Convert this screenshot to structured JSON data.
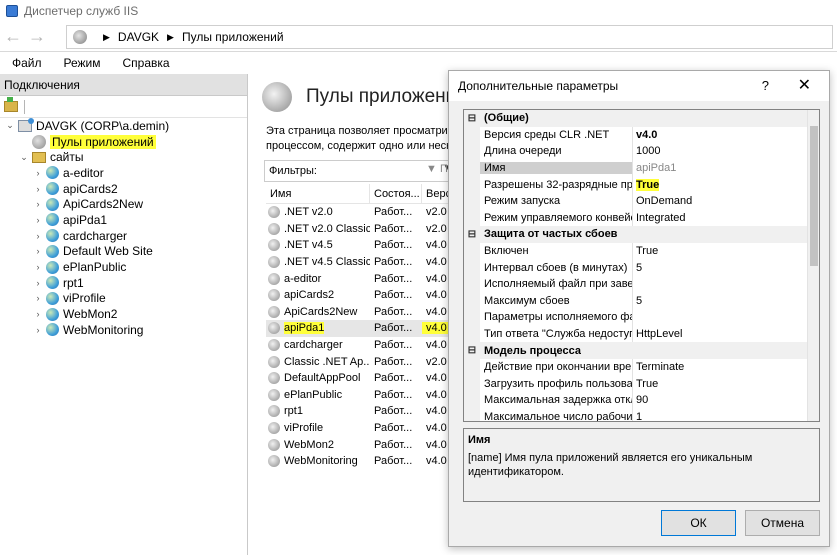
{
  "window": {
    "title": "Диспетчер служб IIS"
  },
  "address": {
    "crumbs": [
      "DAVGK",
      "Пулы приложений"
    ]
  },
  "menu": [
    "Файл",
    "Режим",
    "Справка"
  ],
  "connections": {
    "header": "Подключения",
    "tree": [
      {
        "label": "DAVGK (CORP\\a.demin)",
        "level": 0,
        "exp": "⌄",
        "icon": "server-icon"
      },
      {
        "label": "Пулы приложений",
        "level": 1,
        "exp": "",
        "icon": "app-pools-icon",
        "highlight": true
      },
      {
        "label": "сайты",
        "level": 1,
        "exp": "⌄",
        "icon": "sites-folder-icon"
      },
      {
        "label": "a-editor",
        "level": 2,
        "exp": "›",
        "icon": "site-icon"
      },
      {
        "label": "apiCards2",
        "level": 2,
        "exp": "›",
        "icon": "site-icon"
      },
      {
        "label": "ApiCards2New",
        "level": 2,
        "exp": "›",
        "icon": "site-icon"
      },
      {
        "label": "apiPda1",
        "level": 2,
        "exp": "›",
        "icon": "site-icon"
      },
      {
        "label": "cardcharger",
        "level": 2,
        "exp": "›",
        "icon": "site-icon"
      },
      {
        "label": "Default Web Site",
        "level": 2,
        "exp": "›",
        "icon": "site-icon"
      },
      {
        "label": "ePlanPublic",
        "level": 2,
        "exp": "›",
        "icon": "site-icon"
      },
      {
        "label": "rpt1",
        "level": 2,
        "exp": "›",
        "icon": "site-icon"
      },
      {
        "label": "viProfile",
        "level": 2,
        "exp": "›",
        "icon": "site-icon"
      },
      {
        "label": "WebMon2",
        "level": 2,
        "exp": "›",
        "icon": "site-icon"
      },
      {
        "label": "WebMonitoring",
        "level": 2,
        "exp": "›",
        "icon": "site-icon"
      }
    ]
  },
  "pools": {
    "title": "Пулы приложений",
    "description": [
      "Эта страница позволяет просматривать",
      "процессом, содержит одно или неско"
    ],
    "filter_label": "Фильтры:",
    "go_label": "▼ П",
    "columns": [
      "Имя",
      "Состоя...",
      "Верс"
    ],
    "rows": [
      {
        "name": ".NET v2.0",
        "state": "Работ...",
        "ver": "v2.0"
      },
      {
        "name": ".NET v2.0 Classic",
        "state": "Работ...",
        "ver": "v2.0"
      },
      {
        "name": ".NET v4.5",
        "state": "Работ...",
        "ver": "v4.0"
      },
      {
        "name": ".NET v4.5 Classic",
        "state": "Работ...",
        "ver": "v4.0"
      },
      {
        "name": "a-editor",
        "state": "Работ...",
        "ver": "v4.0"
      },
      {
        "name": "apiCards2",
        "state": "Работ...",
        "ver": "v4.0"
      },
      {
        "name": "ApiCards2New",
        "state": "Работ...",
        "ver": "v4.0"
      },
      {
        "name": "apiPda1",
        "state": "Работ...",
        "ver": "v4.0",
        "selected": true
      },
      {
        "name": "cardcharger",
        "state": "Работ...",
        "ver": "v4.0"
      },
      {
        "name": "Classic .NET Ap...",
        "state": "Работ...",
        "ver": "v2.0"
      },
      {
        "name": "DefaultAppPool",
        "state": "Работ...",
        "ver": "v4.0"
      },
      {
        "name": "ePlanPublic",
        "state": "Работ...",
        "ver": "v4.0"
      },
      {
        "name": "rpt1",
        "state": "Работ...",
        "ver": "v4.0"
      },
      {
        "name": "viProfile",
        "state": "Работ...",
        "ver": "v4.0"
      },
      {
        "name": "WebMon2",
        "state": "Работ...",
        "ver": "v4.0"
      },
      {
        "name": "WebMonitoring",
        "state": "Работ...",
        "ver": "v4.0"
      }
    ]
  },
  "dialog": {
    "title": "Дополнительные параметры",
    "help": "?",
    "close": "✕",
    "props": [
      {
        "cat": true,
        "name": "(Общие)"
      },
      {
        "name": "Версия среды CLR .NET",
        "value": "v4.0",
        "style": "bold"
      },
      {
        "name": "Длина очереди",
        "value": "1000"
      },
      {
        "name": "Имя",
        "value": "apiPda1",
        "style": "gray",
        "selected": true
      },
      {
        "name": "Разрешены 32-разрядные при",
        "value": "True",
        "style": "hl"
      },
      {
        "name": "Режим запуска",
        "value": "OnDemand"
      },
      {
        "name": "Режим управляемого конвейе",
        "value": "Integrated"
      },
      {
        "cat": true,
        "name": "Защита от частых сбоев"
      },
      {
        "name": "Включен",
        "value": "True"
      },
      {
        "name": "Интервал сбоев (в минутах)",
        "value": "5"
      },
      {
        "name": "Исполняемый файл при завер",
        "value": ""
      },
      {
        "name": "Максимум сбоев",
        "value": "5"
      },
      {
        "name": "Параметры исполняемого фаі",
        "value": ""
      },
      {
        "name": "Тип ответа \"Служба недоступн",
        "value": "HttpLevel"
      },
      {
        "cat": true,
        "name": "Модель процесса"
      },
      {
        "name": "Действие при окончании врем",
        "value": "Terminate"
      },
      {
        "name": "Загрузить профиль пользовате",
        "value": "True"
      },
      {
        "name": "Максимальная задержка откл",
        "value": "90"
      },
      {
        "name": "Максимальное число рабочих",
        "value": "1"
      }
    ],
    "desc_name": "Имя",
    "desc_text": "[name] Имя пула приложений является его уникальным идентификатором.",
    "ok_label": "ОК",
    "cancel_label": "Отмена"
  },
  "colors": {
    "highlight": "#ffff3a",
    "ok_border": "#0078d7"
  }
}
